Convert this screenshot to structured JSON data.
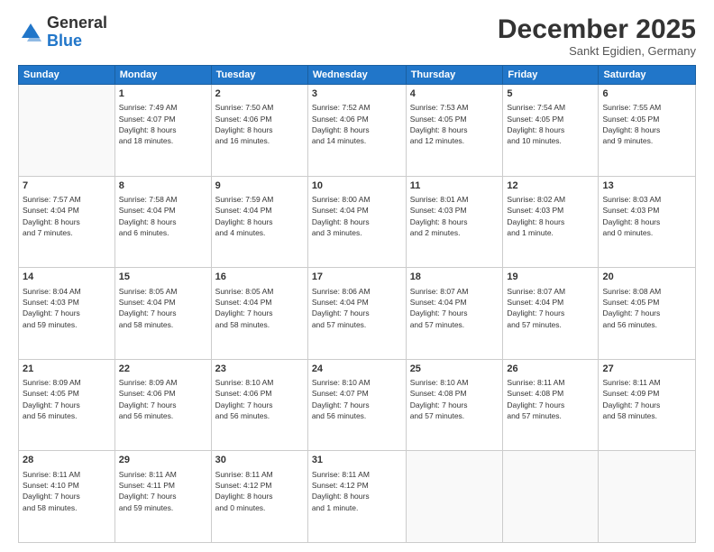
{
  "logo": {
    "general": "General",
    "blue": "Blue"
  },
  "header": {
    "month": "December 2025",
    "location": "Sankt Egidien, Germany"
  },
  "weekdays": [
    "Sunday",
    "Monday",
    "Tuesday",
    "Wednesday",
    "Thursday",
    "Friday",
    "Saturday"
  ],
  "weeks": [
    [
      {
        "day": "",
        "info": ""
      },
      {
        "day": "1",
        "info": "Sunrise: 7:49 AM\nSunset: 4:07 PM\nDaylight: 8 hours\nand 18 minutes."
      },
      {
        "day": "2",
        "info": "Sunrise: 7:50 AM\nSunset: 4:06 PM\nDaylight: 8 hours\nand 16 minutes."
      },
      {
        "day": "3",
        "info": "Sunrise: 7:52 AM\nSunset: 4:06 PM\nDaylight: 8 hours\nand 14 minutes."
      },
      {
        "day": "4",
        "info": "Sunrise: 7:53 AM\nSunset: 4:05 PM\nDaylight: 8 hours\nand 12 minutes."
      },
      {
        "day": "5",
        "info": "Sunrise: 7:54 AM\nSunset: 4:05 PM\nDaylight: 8 hours\nand 10 minutes."
      },
      {
        "day": "6",
        "info": "Sunrise: 7:55 AM\nSunset: 4:05 PM\nDaylight: 8 hours\nand 9 minutes."
      }
    ],
    [
      {
        "day": "7",
        "info": "Sunrise: 7:57 AM\nSunset: 4:04 PM\nDaylight: 8 hours\nand 7 minutes."
      },
      {
        "day": "8",
        "info": "Sunrise: 7:58 AM\nSunset: 4:04 PM\nDaylight: 8 hours\nand 6 minutes."
      },
      {
        "day": "9",
        "info": "Sunrise: 7:59 AM\nSunset: 4:04 PM\nDaylight: 8 hours\nand 4 minutes."
      },
      {
        "day": "10",
        "info": "Sunrise: 8:00 AM\nSunset: 4:04 PM\nDaylight: 8 hours\nand 3 minutes."
      },
      {
        "day": "11",
        "info": "Sunrise: 8:01 AM\nSunset: 4:03 PM\nDaylight: 8 hours\nand 2 minutes."
      },
      {
        "day": "12",
        "info": "Sunrise: 8:02 AM\nSunset: 4:03 PM\nDaylight: 8 hours\nand 1 minute."
      },
      {
        "day": "13",
        "info": "Sunrise: 8:03 AM\nSunset: 4:03 PM\nDaylight: 8 hours\nand 0 minutes."
      }
    ],
    [
      {
        "day": "14",
        "info": "Sunrise: 8:04 AM\nSunset: 4:03 PM\nDaylight: 7 hours\nand 59 minutes."
      },
      {
        "day": "15",
        "info": "Sunrise: 8:05 AM\nSunset: 4:04 PM\nDaylight: 7 hours\nand 58 minutes."
      },
      {
        "day": "16",
        "info": "Sunrise: 8:05 AM\nSunset: 4:04 PM\nDaylight: 7 hours\nand 58 minutes."
      },
      {
        "day": "17",
        "info": "Sunrise: 8:06 AM\nSunset: 4:04 PM\nDaylight: 7 hours\nand 57 minutes."
      },
      {
        "day": "18",
        "info": "Sunrise: 8:07 AM\nSunset: 4:04 PM\nDaylight: 7 hours\nand 57 minutes."
      },
      {
        "day": "19",
        "info": "Sunrise: 8:07 AM\nSunset: 4:04 PM\nDaylight: 7 hours\nand 57 minutes."
      },
      {
        "day": "20",
        "info": "Sunrise: 8:08 AM\nSunset: 4:05 PM\nDaylight: 7 hours\nand 56 minutes."
      }
    ],
    [
      {
        "day": "21",
        "info": "Sunrise: 8:09 AM\nSunset: 4:05 PM\nDaylight: 7 hours\nand 56 minutes."
      },
      {
        "day": "22",
        "info": "Sunrise: 8:09 AM\nSunset: 4:06 PM\nDaylight: 7 hours\nand 56 minutes."
      },
      {
        "day": "23",
        "info": "Sunrise: 8:10 AM\nSunset: 4:06 PM\nDaylight: 7 hours\nand 56 minutes."
      },
      {
        "day": "24",
        "info": "Sunrise: 8:10 AM\nSunset: 4:07 PM\nDaylight: 7 hours\nand 56 minutes."
      },
      {
        "day": "25",
        "info": "Sunrise: 8:10 AM\nSunset: 4:08 PM\nDaylight: 7 hours\nand 57 minutes."
      },
      {
        "day": "26",
        "info": "Sunrise: 8:11 AM\nSunset: 4:08 PM\nDaylight: 7 hours\nand 57 minutes."
      },
      {
        "day": "27",
        "info": "Sunrise: 8:11 AM\nSunset: 4:09 PM\nDaylight: 7 hours\nand 58 minutes."
      }
    ],
    [
      {
        "day": "28",
        "info": "Sunrise: 8:11 AM\nSunset: 4:10 PM\nDaylight: 7 hours\nand 58 minutes."
      },
      {
        "day": "29",
        "info": "Sunrise: 8:11 AM\nSunset: 4:11 PM\nDaylight: 7 hours\nand 59 minutes."
      },
      {
        "day": "30",
        "info": "Sunrise: 8:11 AM\nSunset: 4:12 PM\nDaylight: 8 hours\nand 0 minutes."
      },
      {
        "day": "31",
        "info": "Sunrise: 8:11 AM\nSunset: 4:12 PM\nDaylight: 8 hours\nand 1 minute."
      },
      {
        "day": "",
        "info": ""
      },
      {
        "day": "",
        "info": ""
      },
      {
        "day": "",
        "info": ""
      }
    ]
  ]
}
